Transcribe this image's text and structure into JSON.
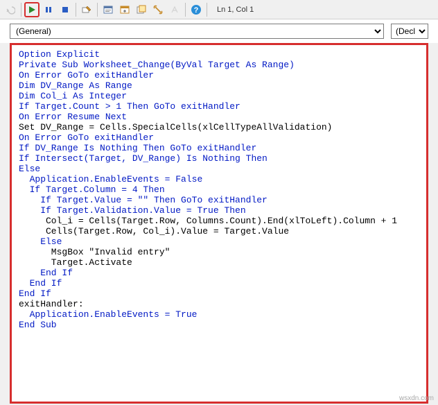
{
  "toolbar": {
    "status": "Ln 1, Col 1"
  },
  "dropdowns": {
    "object": "(General)",
    "procedure": "(Declara"
  },
  "code": {
    "lines": [
      {
        "text": "Option Explicit",
        "cls": "kw"
      },
      {
        "text": "Private Sub Worksheet_Change(ByVal Target As Range)",
        "cls": "kw"
      },
      {
        "text": "On Error GoTo exitHandler",
        "cls": "kw"
      },
      {
        "text": "",
        "cls": ""
      },
      {
        "text": "Dim DV_Range As Range",
        "cls": "kw"
      },
      {
        "text": "Dim Col_i As Integer",
        "cls": "kw"
      },
      {
        "text": "",
        "cls": ""
      },
      {
        "text": "If Target.Count > 1 Then GoTo exitHandler",
        "cls": "kw"
      },
      {
        "text": "",
        "cls": ""
      },
      {
        "text": "On Error Resume Next",
        "cls": "kw"
      },
      {
        "text": "Set DV_Range = Cells.SpecialCells(xlCellTypeAllValidation)",
        "cls": ""
      },
      {
        "text": "On Error GoTo exitHandler",
        "cls": "kw"
      },
      {
        "text": "If DV_Range Is Nothing Then GoTo exitHandler",
        "cls": "kw"
      },
      {
        "text": "If Intersect(Target, DV_Range) Is Nothing Then",
        "cls": "kw"
      },
      {
        "text": "Else",
        "cls": "kw"
      },
      {
        "text": "  Application.EnableEvents = False",
        "cls": "kw"
      },
      {
        "text": "  If Target.Column = 4 Then",
        "cls": "kw"
      },
      {
        "text": "    If Target.Value = \"\" Then GoTo exitHandler",
        "cls": "kw"
      },
      {
        "text": "    If Target.Validation.Value = True Then",
        "cls": "kw"
      },
      {
        "text": "     Col_i = Cells(Target.Row, Columns.Count).End(xlToLeft).Column + 1",
        "cls": ""
      },
      {
        "text": "     Cells(Target.Row, Col_i).Value = Target.Value",
        "cls": ""
      },
      {
        "text": "    Else",
        "cls": "kw"
      },
      {
        "text": "      MsgBox \"Invalid entry\"",
        "cls": ""
      },
      {
        "text": "      Target.Activate",
        "cls": ""
      },
      {
        "text": "    End If",
        "cls": "kw"
      },
      {
        "text": "  End If",
        "cls": "kw"
      },
      {
        "text": "End If",
        "cls": "kw"
      },
      {
        "text": "",
        "cls": ""
      },
      {
        "text": "exitHandler:",
        "cls": ""
      },
      {
        "text": "  Application.EnableEvents = True",
        "cls": "kw"
      },
      {
        "text": "",
        "cls": ""
      },
      {
        "text": "End Sub",
        "cls": "kw"
      }
    ]
  },
  "watermark": "wsxdn.com"
}
